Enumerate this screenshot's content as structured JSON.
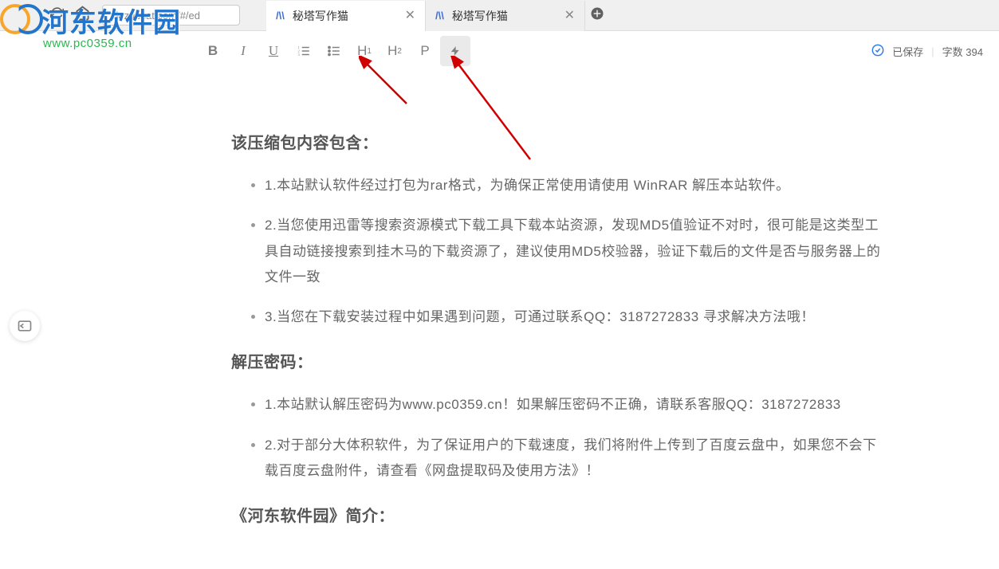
{
  "browser": {
    "url": "xiezuocat.com/#/ed",
    "tabs": [
      {
        "title": "秘塔写作猫",
        "active": true
      },
      {
        "title": "秘塔写作猫",
        "active": false
      }
    ]
  },
  "toolbar": {
    "buttons": {
      "bold": "B",
      "italic": "I",
      "underline": "U",
      "ordered_list": "",
      "unordered_list": "",
      "h1_main": "H",
      "h1_sub": "1",
      "h2_main": "H",
      "h2_sub": "2",
      "paragraph": "P",
      "lightning": "⚡"
    },
    "status": {
      "saved_label": "已保存",
      "word_count_label": "字数",
      "word_count_value": "394"
    }
  },
  "document": {
    "heading1": "该压缩包内容包含：",
    "list1": [
      "1.本站默认软件经过打包为rar格式，为确保正常使用请使用 WinRAR 解压本站软件。",
      "2.当您使用迅雷等搜索资源模式下载工具下载本站资源，发现MD5值验证不对时，很可能是这类型工具自动链接搜索到挂木马的下载资源了，建议使用MD5校验器，验证下载后的文件是否与服务器上的文件一致",
      "3.当您在下载安装过程中如果遇到问题，可通过联系QQ：3187272833 寻求解决方法哦！"
    ],
    "heading2": "解压密码：",
    "list2": [
      "1.本站默认解压密码为www.pc0359.cn！如果解压密码不正确，请联系客服QQ：3187272833",
      "2.对于部分大体积软件，为了保证用户的下载速度，我们将附件上传到了百度云盘中，如果您不会下载百度云盘附件，请查看《网盘提取码及使用方法》！"
    ],
    "heading3": "《河东软件园》简介："
  },
  "watermark": {
    "site_name": "河东软件园",
    "site_url": "www.pc0359.cn"
  }
}
